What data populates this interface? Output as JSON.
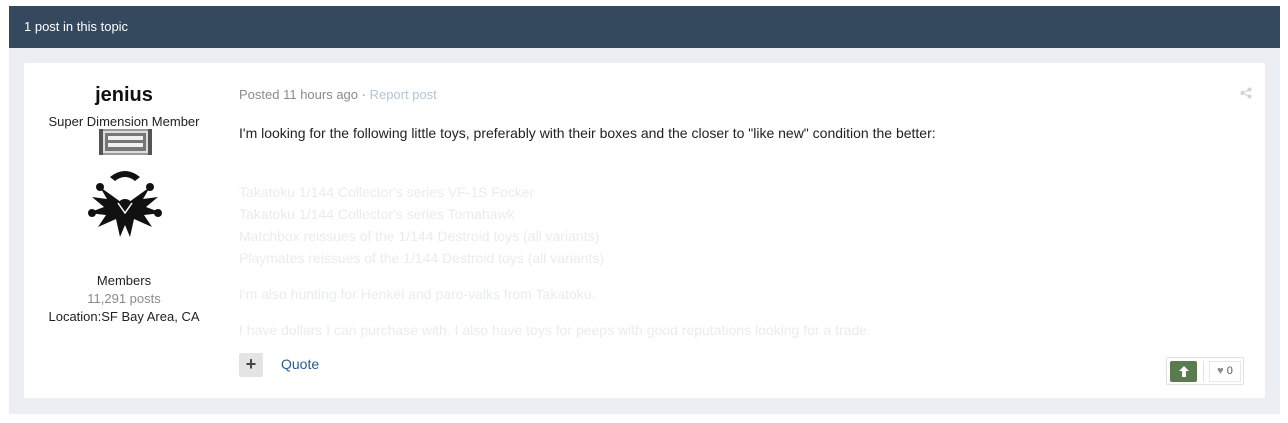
{
  "topic": {
    "count_label": "1 post in this topic"
  },
  "author": {
    "name": "jenius",
    "title": "Super Dimension Member",
    "group": "Members",
    "post_count": "11,291 posts",
    "location": "Location:SF Bay Area, CA"
  },
  "post": {
    "posted": "Posted 11 hours ago",
    "separator": " · ",
    "report_label": "Report post",
    "intro": "I'm looking for the following little toys, preferably with their boxes and the closer to \"like new\" condition the better:",
    "items": [
      "Takatoku 1/144 Collector's series VF-1S Focker",
      "Takatoku 1/144 Collector's series Tomahawk",
      "Matchbox reissues of the 1/144 Destroid toys (all variants)",
      "Playmates reissues of the 1/144 Destroid toys (all variants)"
    ],
    "hunting": "I'm also hunting for Henkei and paro-valks from Takatoku.",
    "trade": "I have dollars I can purchase with. I also have toys for peeps with good reputations looking for a trade."
  },
  "actions": {
    "multiquote_label": "+",
    "quote_label": "Quote",
    "upvote_icon": "arrow-up-icon",
    "reputation_icon": "heart-icon",
    "reputation_count": "0"
  },
  "colors": {
    "topic_bar": "#34495e",
    "link": "#2a5d8e",
    "upvote": "#5a7a4f"
  }
}
